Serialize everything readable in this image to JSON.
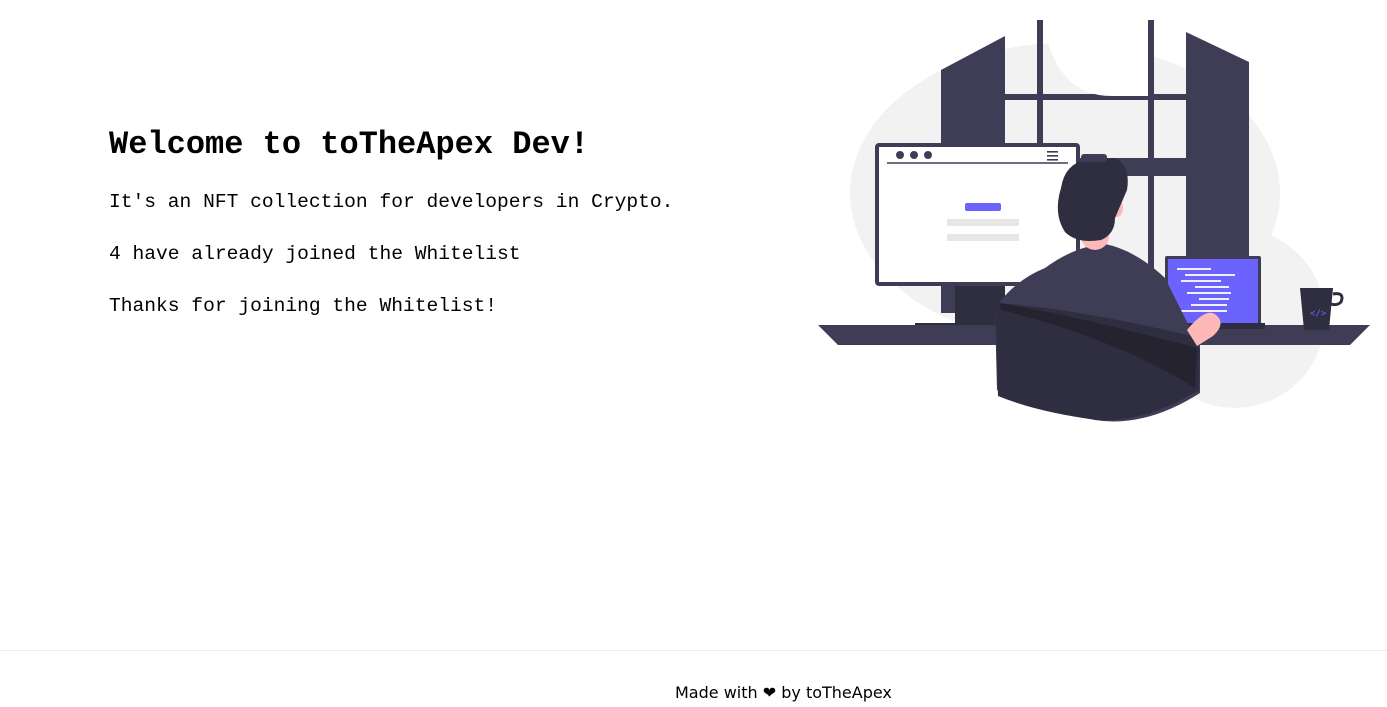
{
  "main": {
    "title": "Welcome to toTheApex Dev!",
    "description": "It's an NFT collection for developers in Crypto.",
    "joined_count_text": "4 have already joined the Whitelist",
    "status_message": "Thanks for joining the Whitelist!"
  },
  "illustration": {
    "name": "developer-at-desk-illustration",
    "accent_color": "#6c63ff",
    "dark_color": "#3f3d56"
  },
  "footer": {
    "made_with": "Made with",
    "heart": "❤",
    "by_text": "by toTheApex"
  }
}
